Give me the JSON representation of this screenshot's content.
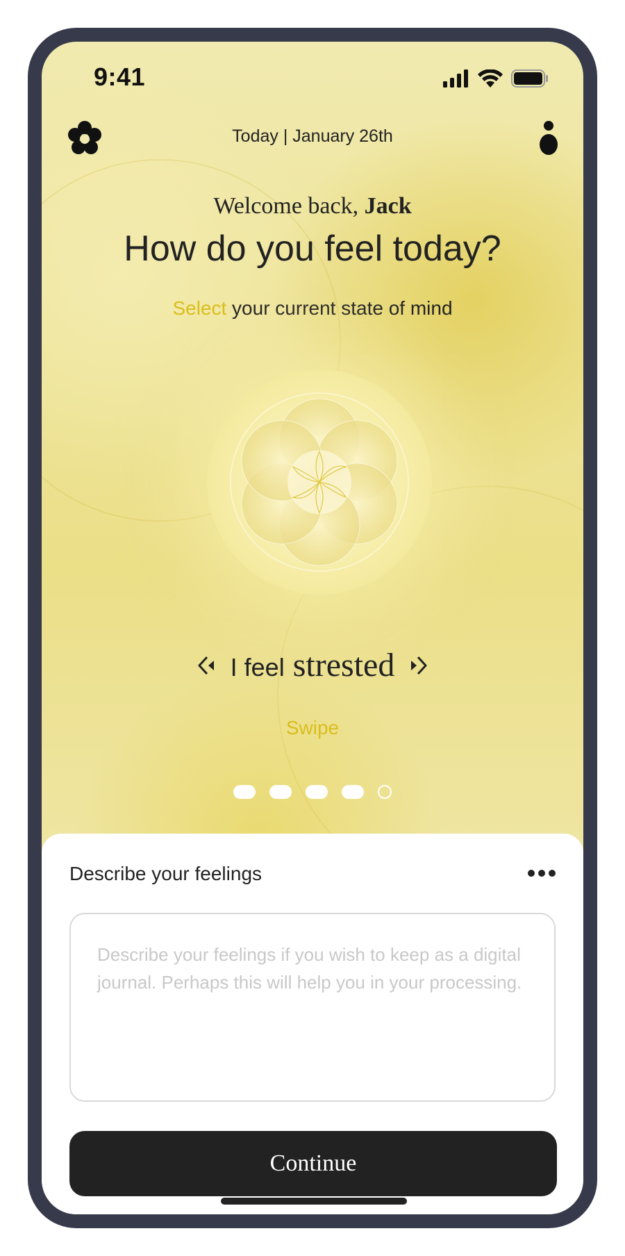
{
  "status_bar": {
    "time": "9:41",
    "icons": [
      "cellular-signal-icon",
      "wifi-icon",
      "battery-icon"
    ]
  },
  "header": {
    "logo_icon": "flower-logo-icon",
    "date": "Today | January 26th",
    "profile_icon": "profile-icon"
  },
  "greeting": {
    "welcome_prefix": "Welcome back, ",
    "user_name": "Jack",
    "question": "How do you feel today?",
    "instruction_accent": "Select",
    "instruction_rest": " your current state of mind"
  },
  "mood_selector": {
    "prefix": "I feel",
    "current_mood": "strested",
    "swipe_hint": "Swipe",
    "total_moods": 5,
    "selected_index": 4
  },
  "journal": {
    "title": "Describe your feelings",
    "placeholder": "Describe your feelings if you wish to keep as a digital journal. Perhaps this will help you in your processing.",
    "value": "",
    "more_icon": "more-dots-icon",
    "continue_label": "Continue"
  },
  "colors": {
    "accent": "#d9be1e",
    "frame": "#363a4a",
    "button": "#222222",
    "background_yellow": "#ebdf88"
  }
}
